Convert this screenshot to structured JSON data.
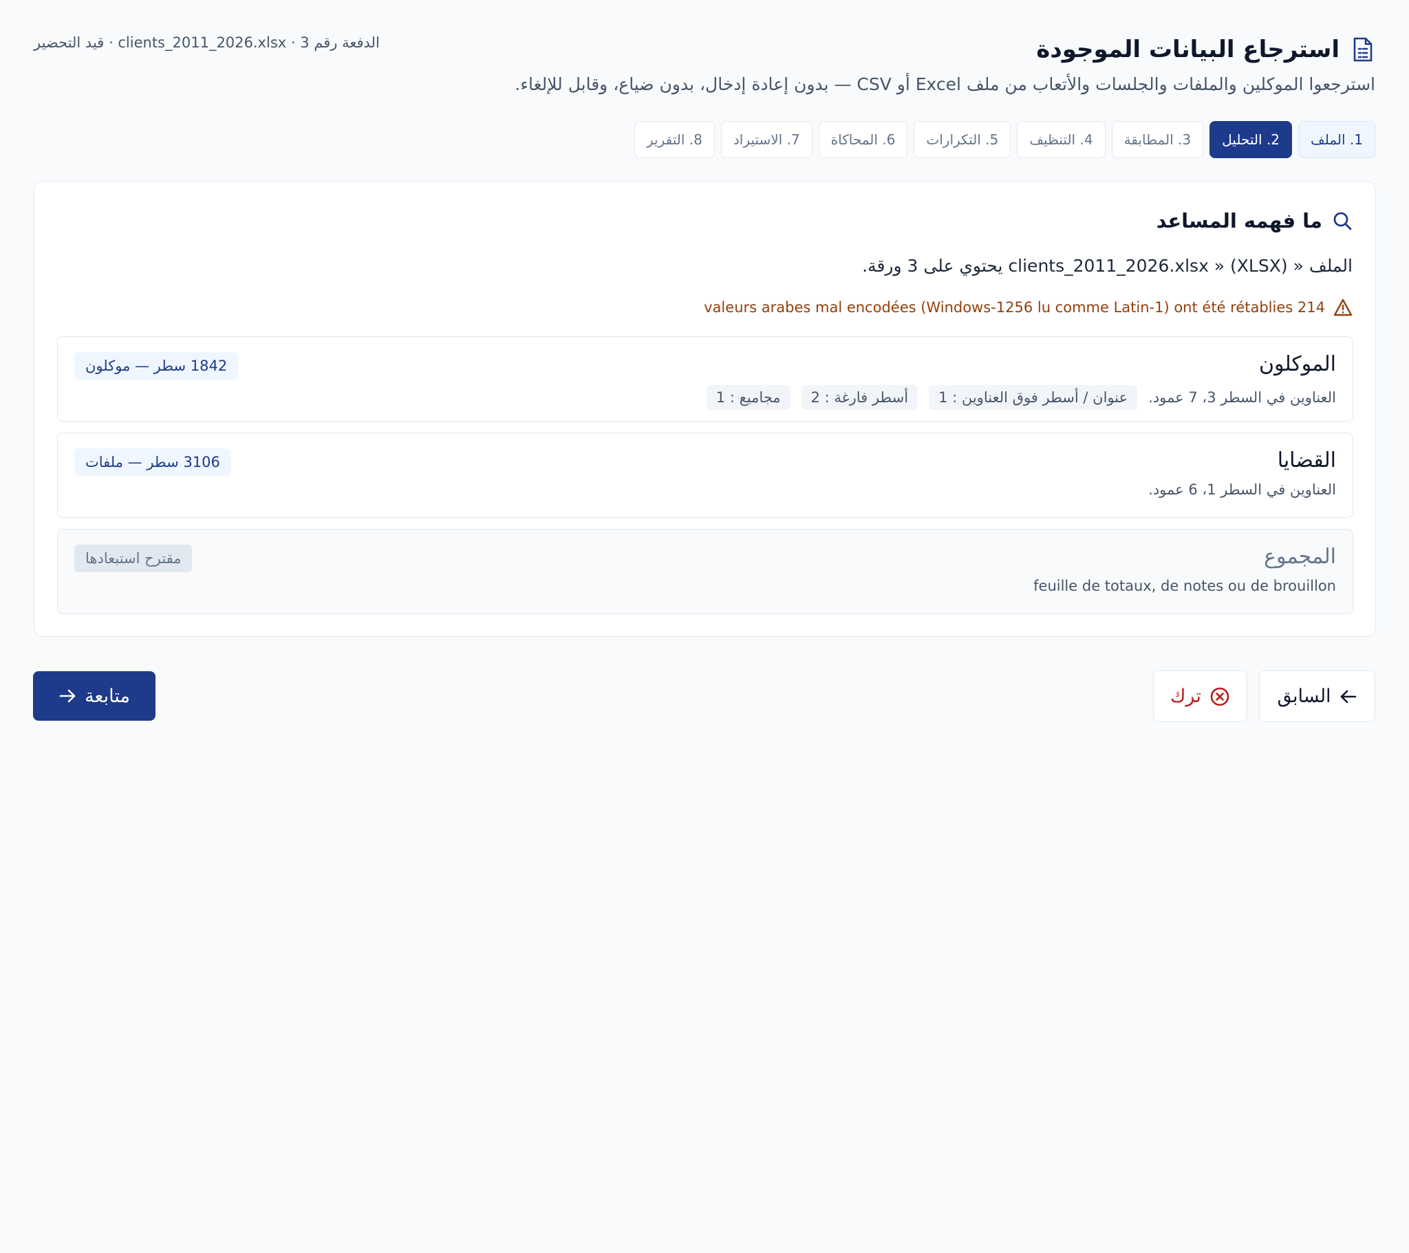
{
  "header": {
    "title": "استرجاع البيانات الموجودة",
    "subtitle": "استرجعوا الموكلين والملفات والجلسات والأتعاب من ملف Excel أو CSV — بدون إعادة إدخال، بدون ضياع، وقابل للإلغاء.",
    "meta": "الدفعة رقم 3 · clients_2011_2026.xlsx · قيد التحضير",
    "icon": "spreadsheet-file-icon"
  },
  "steps": [
    {
      "label": "1. الملف",
      "state": "done"
    },
    {
      "label": "2. التحليل",
      "state": "active"
    },
    {
      "label": "3. المطابقة",
      "state": "pending"
    },
    {
      "label": "4. التنظيف",
      "state": "pending"
    },
    {
      "label": "5. التكرارات",
      "state": "pending"
    },
    {
      "label": "6. المحاكاة",
      "state": "pending"
    },
    {
      "label": "7. الاستيراد",
      "state": "pending"
    },
    {
      "label": "8. التقرير",
      "state": "pending"
    }
  ],
  "analysis": {
    "title": "ما فهمه المساعد",
    "description": "الملف « clients_2011_2026.xlsx » (XLSX) يحتوي على 3 ورقة.",
    "warning": "214 valeurs arabes mal encodées (Windows-1256 lu comme Latin-1) ont été rétablies",
    "sheets": [
      {
        "name": "الموكلون",
        "detail": "العناوين في السطر 3، 7 عمود.",
        "tags": [
          "عنوان / أسطر فوق العناوين : 1",
          "أسطر فارغة : 2",
          "مجاميع : 1"
        ],
        "badge": "1842 سطر — موكلون"
      },
      {
        "name": "القضايا",
        "detail": "العناوين في السطر 1، 6 عمود.",
        "tags": [],
        "badge": "3106 سطر — ملفات"
      },
      {
        "name": "المجموع",
        "detail": "feuille de totaux, de notes ou de brouillon",
        "tags": [],
        "badge": "مقترح استبعادها"
      }
    ]
  },
  "actions": {
    "previous": "السابق",
    "quit": "ترك",
    "next": "متابعة"
  },
  "colors": {
    "primary": "#1e3a8a",
    "danger": "#b91c1c",
    "warning": "#92400e",
    "background": "#f8fafc"
  }
}
